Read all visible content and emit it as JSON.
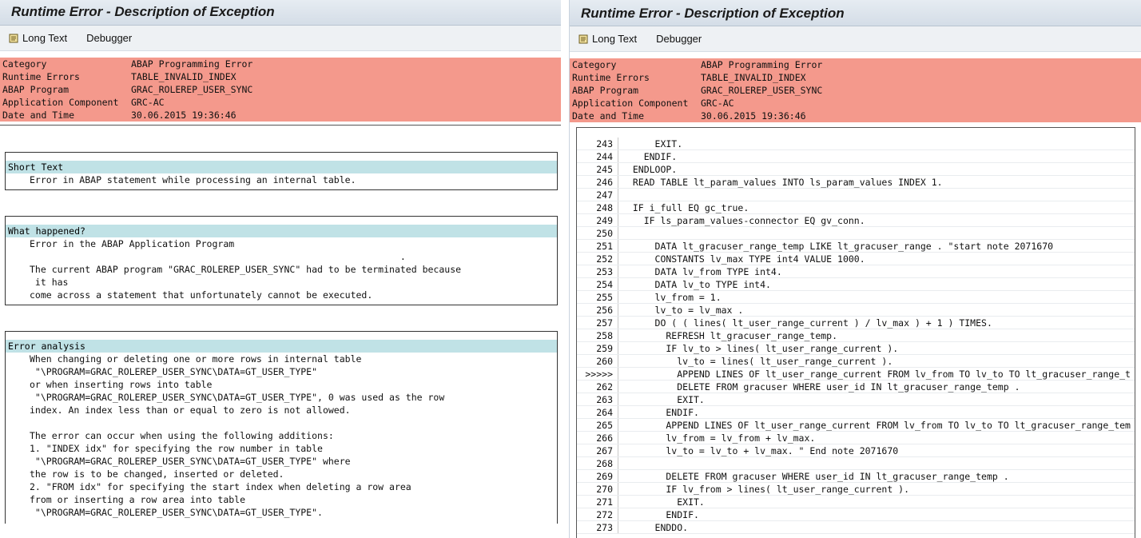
{
  "left": {
    "title": "Runtime Error - Description of Exception",
    "toolbar": {
      "long_text": "Long Text",
      "debugger": "Debugger"
    },
    "header": [
      {
        "key": "Category",
        "value": "ABAP Programming Error"
      },
      {
        "key": "Runtime Errors",
        "value": "TABLE_INVALID_INDEX"
      },
      {
        "key": "ABAP Program",
        "value": "GRAC_ROLEREP_USER_SYNC"
      },
      {
        "key": "Application Component",
        "value": "GRC-AC"
      },
      {
        "key": "Date and Time",
        "value": "30.06.2015 19:36:46"
      }
    ],
    "short_text": {
      "heading": "Short Text",
      "lines": [
        "Error in ABAP statement while processing an internal table."
      ]
    },
    "what_happened": {
      "heading": "What happened?",
      "lines": [
        "Error in the ABAP Application Program",
        "                                                                   .",
        "The current ABAP program \"GRAC_ROLEREP_USER_SYNC\" had to be terminated because",
        " it has",
        "come across a statement that unfortunately cannot be executed."
      ]
    },
    "error_analysis": {
      "heading": "Error analysis",
      "lines": [
        "When changing or deleting one or more rows in internal table",
        " \"\\PROGRAM=GRAC_ROLEREP_USER_SYNC\\DATA=GT_USER_TYPE\"",
        "or when inserting rows into table",
        " \"\\PROGRAM=GRAC_ROLEREP_USER_SYNC\\DATA=GT_USER_TYPE\", 0 was used as the row",
        "index. An index less than or equal to zero is not allowed.",
        "",
        "The error can occur when using the following additions:",
        "1. \"INDEX idx\" for specifying the row number in table",
        " \"\\PROGRAM=GRAC_ROLEREP_USER_SYNC\\DATA=GT_USER_TYPE\" where",
        "the row is to be changed, inserted or deleted.",
        "2. \"FROM idx\" for specifying the start index when deleting a row area",
        "from or inserting a row area into table",
        " \"\\PROGRAM=GRAC_ROLEREP_USER_SYNC\\DATA=GT_USER_TYPE\"."
      ]
    }
  },
  "right": {
    "title": "Runtime Error - Description of Exception",
    "toolbar": {
      "long_text": "Long Text",
      "debugger": "Debugger"
    },
    "header": [
      {
        "key": "Category",
        "value": "ABAP Programming Error"
      },
      {
        "key": "Runtime Errors",
        "value": "TABLE_INVALID_INDEX"
      },
      {
        "key": "ABAP Program",
        "value": "GRAC_ROLEREP_USER_SYNC"
      },
      {
        "key": "Application Component",
        "value": "GRC-AC"
      },
      {
        "key": "Date and Time",
        "value": "30.06.2015 19:36:46"
      }
    ],
    "source_lines": [
      {
        "ln": "243",
        "code": "      EXIT."
      },
      {
        "ln": "244",
        "code": "    ENDIF."
      },
      {
        "ln": "245",
        "code": "  ENDLOOP."
      },
      {
        "ln": "246",
        "code": "  READ TABLE lt_param_values INTO ls_param_values INDEX 1."
      },
      {
        "ln": "247",
        "code": ""
      },
      {
        "ln": "248",
        "code": "  IF i_full EQ gc_true."
      },
      {
        "ln": "249",
        "code": "    IF ls_param_values-connector EQ gv_conn."
      },
      {
        "ln": "250",
        "code": ""
      },
      {
        "ln": "251",
        "code": "      DATA lt_gracuser_range_temp LIKE lt_gracuser_range . \"start note 2071670"
      },
      {
        "ln": "252",
        "code": "      CONSTANTS lv_max TYPE int4 VALUE 1000."
      },
      {
        "ln": "253",
        "code": "      DATA lv_from TYPE int4."
      },
      {
        "ln": "254",
        "code": "      DATA lv_to TYPE int4."
      },
      {
        "ln": "255",
        "code": "      lv_from = 1."
      },
      {
        "ln": "256",
        "code": "      lv_to = lv_max ."
      },
      {
        "ln": "257",
        "code": "      DO ( ( lines( lt_user_range_current ) / lv_max ) + 1 ) TIMES."
      },
      {
        "ln": "258",
        "code": "        REFRESH lt_gracuser_range_temp."
      },
      {
        "ln": "259",
        "code": "        IF lv_to > lines( lt_user_range_current )."
      },
      {
        "ln": "260",
        "code": "          lv_to = lines( lt_user_range_current )."
      },
      {
        "ln": ">>>>>",
        "code": "          APPEND LINES OF lt_user_range_current FROM lv_from TO lv_to TO lt_gracuser_range_t"
      },
      {
        "ln": "262",
        "code": "          DELETE FROM gracuser WHERE user_id IN lt_gracuser_range_temp ."
      },
      {
        "ln": "263",
        "code": "          EXIT."
      },
      {
        "ln": "264",
        "code": "        ENDIF."
      },
      {
        "ln": "265",
        "code": "        APPEND LINES OF lt_user_range_current FROM lv_from TO lv_to TO lt_gracuser_range_tem"
      },
      {
        "ln": "266",
        "code": "        lv_from = lv_from + lv_max."
      },
      {
        "ln": "267",
        "code": "        lv_to = lv_to + lv_max. \" End note 2071670"
      },
      {
        "ln": "268",
        "code": ""
      },
      {
        "ln": "269",
        "code": "        DELETE FROM gracuser WHERE user_id IN lt_gracuser_range_temp ."
      },
      {
        "ln": "270",
        "code": "        IF lv_from > lines( lt_user_range_current )."
      },
      {
        "ln": "271",
        "code": "          EXIT."
      },
      {
        "ln": "272",
        "code": "        ENDIF."
      },
      {
        "ln": "273",
        "code": "      ENDDO."
      }
    ]
  }
}
